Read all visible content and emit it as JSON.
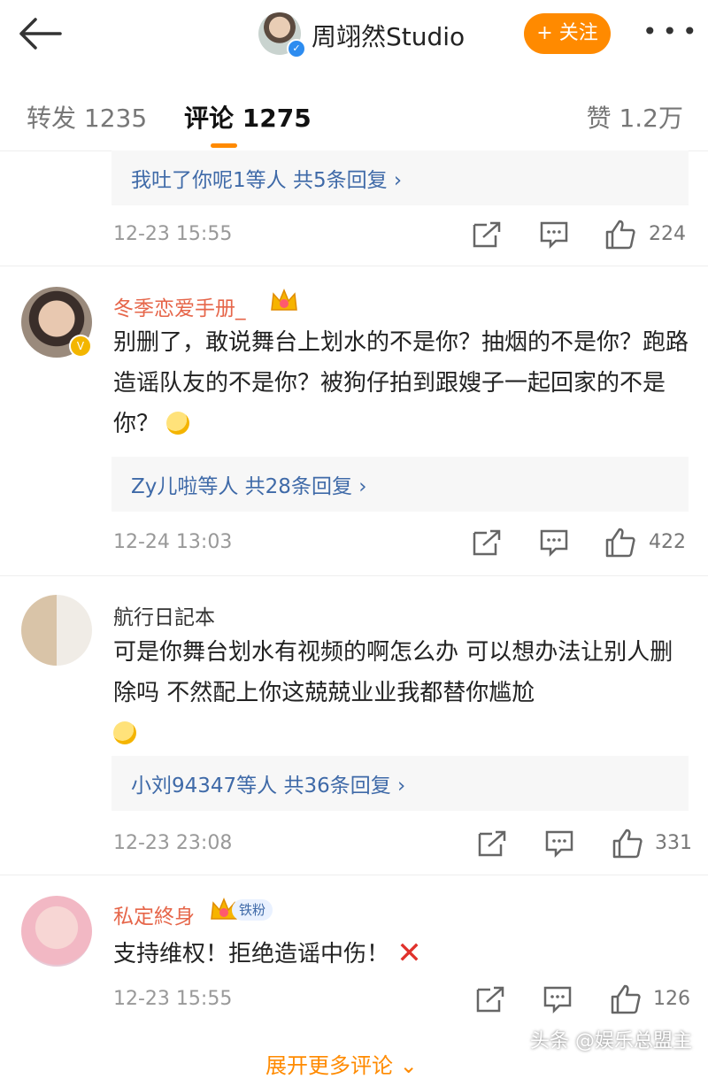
{
  "header": {
    "account_name": "周翊然Studio",
    "follow_label": "+ 关注",
    "more_label": "•••"
  },
  "tabs": {
    "repost": "转发 1235",
    "comments": "评论 1275",
    "likes": "赞 1.2万"
  },
  "comments": [
    {
      "reply_summary": "我吐了你呢1等人  共5条回复 ›",
      "time": "12-23 15:55",
      "likes": "224"
    },
    {
      "username": "冬季恋爱手册_",
      "text": "别删了，敢说舞台上划水的不是你？抽烟的不是你？跑路造谣队友的不是你？被狗仔拍到跟嫂子一起回家的不是你？",
      "reply_summary": "Zy儿啦等人  共28条回复 ›",
      "time": "12-24 13:03",
      "likes": "422"
    },
    {
      "username": "航行日記本",
      "text": "可是你舞台划水有视频的啊怎么办 可以想办法让别人删除吗 不然配上你这兢兢业业我都替你尴尬",
      "reply_summary": "小刘94347等人  共36条回复 ›",
      "time": "12-23 23:08",
      "likes": "331"
    },
    {
      "username": "私定終身",
      "fan_tag": "铁粉",
      "text": "支持维权！拒绝造谣中伤！",
      "time": "12-23 15:55",
      "likes": "126"
    }
  ],
  "watermark": "头条 @娱乐总盟主",
  "expand_label": "展开更多评论 ⌄",
  "colors": {
    "accent": "#ff8a00",
    "link": "#3f6aa8",
    "username": "#e6664a"
  }
}
